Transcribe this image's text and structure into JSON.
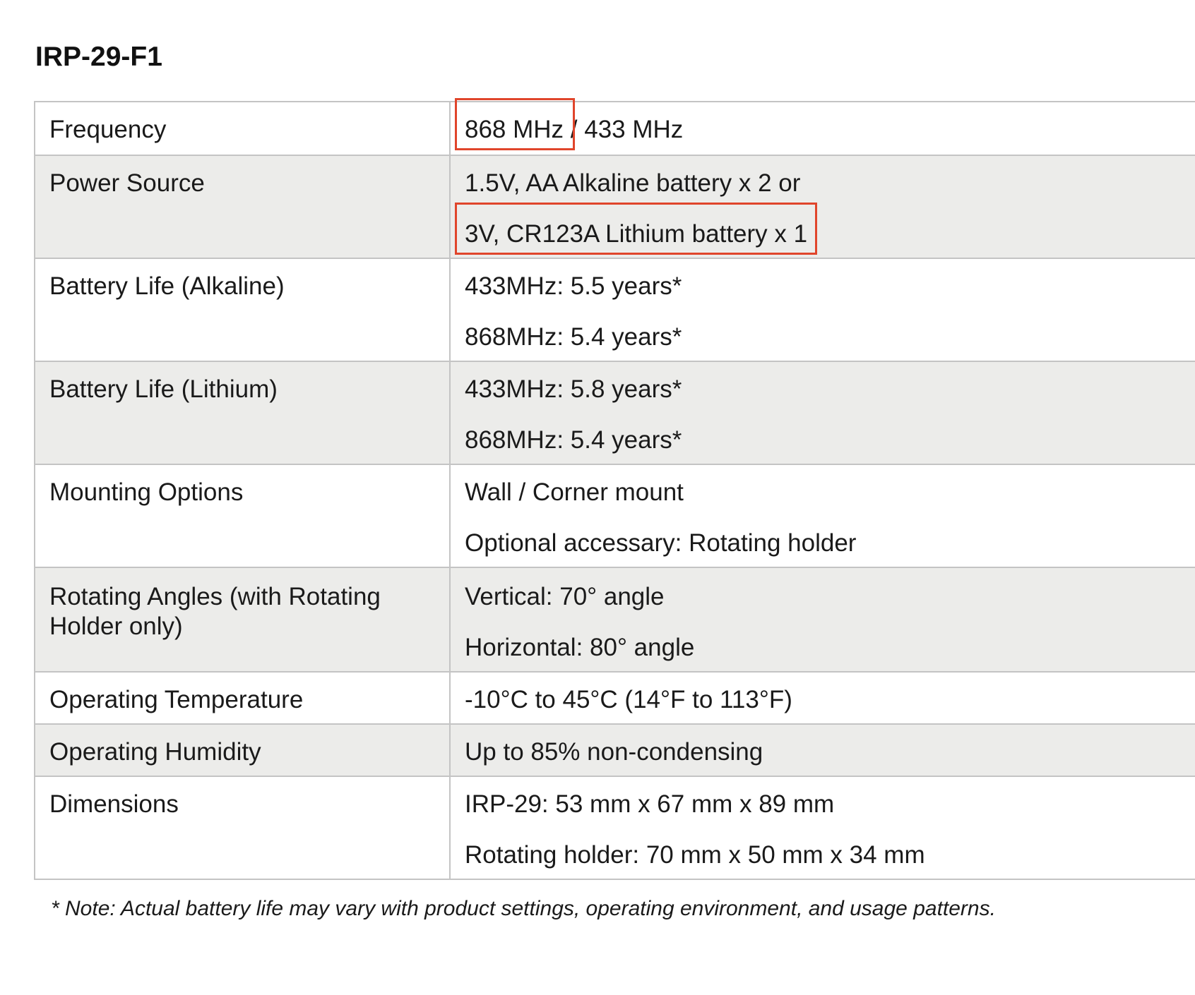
{
  "document": {
    "title": "IRP-29-F1",
    "specs": [
      {
        "label": "Frequency",
        "values": [
          "868 MHz",
          " / 433 MHz"
        ]
      },
      {
        "label": "Power Source",
        "values": [
          "1.5V, AA Alkaline battery x 2 or",
          "3V, CR123A Lithium battery x 1"
        ]
      },
      {
        "label": "Battery Life (Alkaline)",
        "values": [
          "433MHz: 5.5 years*",
          "868MHz: 5.4 years*"
        ]
      },
      {
        "label": "Battery Life (Lithium)",
        "values": [
          "433MHz: 5.8 years*",
          "868MHz: 5.4 years*"
        ]
      },
      {
        "label": "Mounting Options",
        "values": [
          "Wall / Corner mount",
          "Optional accessary: Rotating holder"
        ]
      },
      {
        "label_lines": [
          "Rotating Angles (with Rotating",
          "Holder only)"
        ],
        "values": [
          "Vertical: 70° angle",
          "Horizontal: 80° angle"
        ]
      },
      {
        "label": "Operating Temperature",
        "values": [
          "-10°C to 45°C (14°F to 113°F)"
        ]
      },
      {
        "label": "Operating Humidity",
        "values": [
          "Up to 85% non-condensing"
        ]
      },
      {
        "label": "Dimensions",
        "values": [
          "IRP-29: 53 mm x 67 mm x 89 mm",
          "Rotating holder: 70 mm x 50 mm x 34 mm"
        ]
      }
    ],
    "note": "* Note: Actual battery life may vary with product settings, operating environment, and usage patterns."
  },
  "colors": {
    "highlight_box": "#e0452b",
    "shaded_row": "#ececea",
    "border": "#c4c4c4"
  }
}
